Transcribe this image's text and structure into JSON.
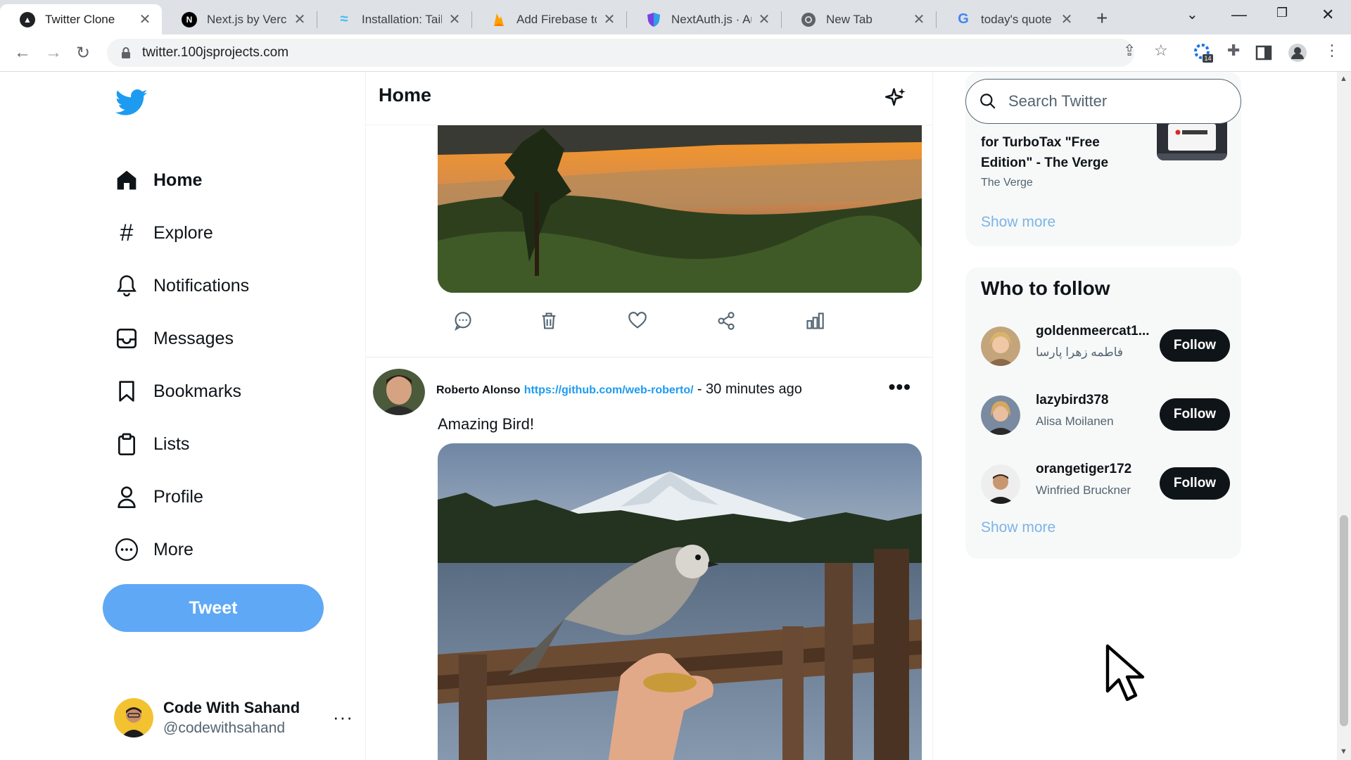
{
  "browser": {
    "tabs": [
      {
        "title": "Twitter Clone",
        "active": true,
        "icon": "twitter-clone-favicon"
      },
      {
        "title": "Next.js by Vercel",
        "active": false,
        "icon": "nextjs-favicon"
      },
      {
        "title": "Installation: Tailw",
        "active": false,
        "icon": "tailwind-favicon"
      },
      {
        "title": "Add Firebase to y",
        "active": false,
        "icon": "firebase-favicon"
      },
      {
        "title": "NextAuth.js · Aut",
        "active": false,
        "icon": "nextauth-favicon"
      },
      {
        "title": "New Tab",
        "active": false,
        "icon": "chrome-favicon"
      },
      {
        "title": "today's quote - G",
        "active": false,
        "icon": "google-favicon"
      }
    ],
    "url": "twitter.100jsprojects.com",
    "extension_badge": "14"
  },
  "sidebar": {
    "nav": [
      {
        "label": "Home",
        "icon": "home-icon",
        "active": true
      },
      {
        "label": "Explore",
        "icon": "hashtag-icon",
        "active": false
      },
      {
        "label": "Notifications",
        "icon": "bell-icon",
        "active": false
      },
      {
        "label": "Messages",
        "icon": "inbox-icon",
        "active": false
      },
      {
        "label": "Bookmarks",
        "icon": "bookmark-icon",
        "active": false
      },
      {
        "label": "Lists",
        "icon": "clipboard-icon",
        "active": false
      },
      {
        "label": "Profile",
        "icon": "user-icon",
        "active": false
      },
      {
        "label": "More",
        "icon": "more-circle-icon",
        "active": false
      }
    ],
    "tweet_button": "Tweet",
    "user": {
      "name": "Code With Sahand",
      "handle": "@codewithsahand",
      "more": "···"
    }
  },
  "feed": {
    "title": "Home",
    "post": {
      "author": "Roberto Alonso",
      "link": "https://github.com/web-roberto/",
      "time": "- 30 minutes ago",
      "text": "Amazing Bird!",
      "more": "•••"
    }
  },
  "right": {
    "search_placeholder": "Search Twitter",
    "news": {
      "title": "for TurboTax \"Free Edition\" - The Verge",
      "source": "The Verge",
      "show_more": "Show more"
    },
    "who_to_follow": {
      "title": "Who to follow",
      "users": [
        {
          "username": "goldenmeercat1...",
          "name": "فاطمه زهرا پارسا",
          "button": "Follow"
        },
        {
          "username": "lazybird378",
          "name": "Alisa Moilanen",
          "button": "Follow"
        },
        {
          "username": "orangetiger172",
          "name": "Winfried Bruckner",
          "button": "Follow"
        }
      ],
      "show_more": "Show more"
    }
  },
  "colors": {
    "twitter_blue": "#1d9bf0",
    "tweet_button": "#5ea8f5",
    "follow_button": "#0f1419",
    "card_bg": "#f7f9f9"
  }
}
